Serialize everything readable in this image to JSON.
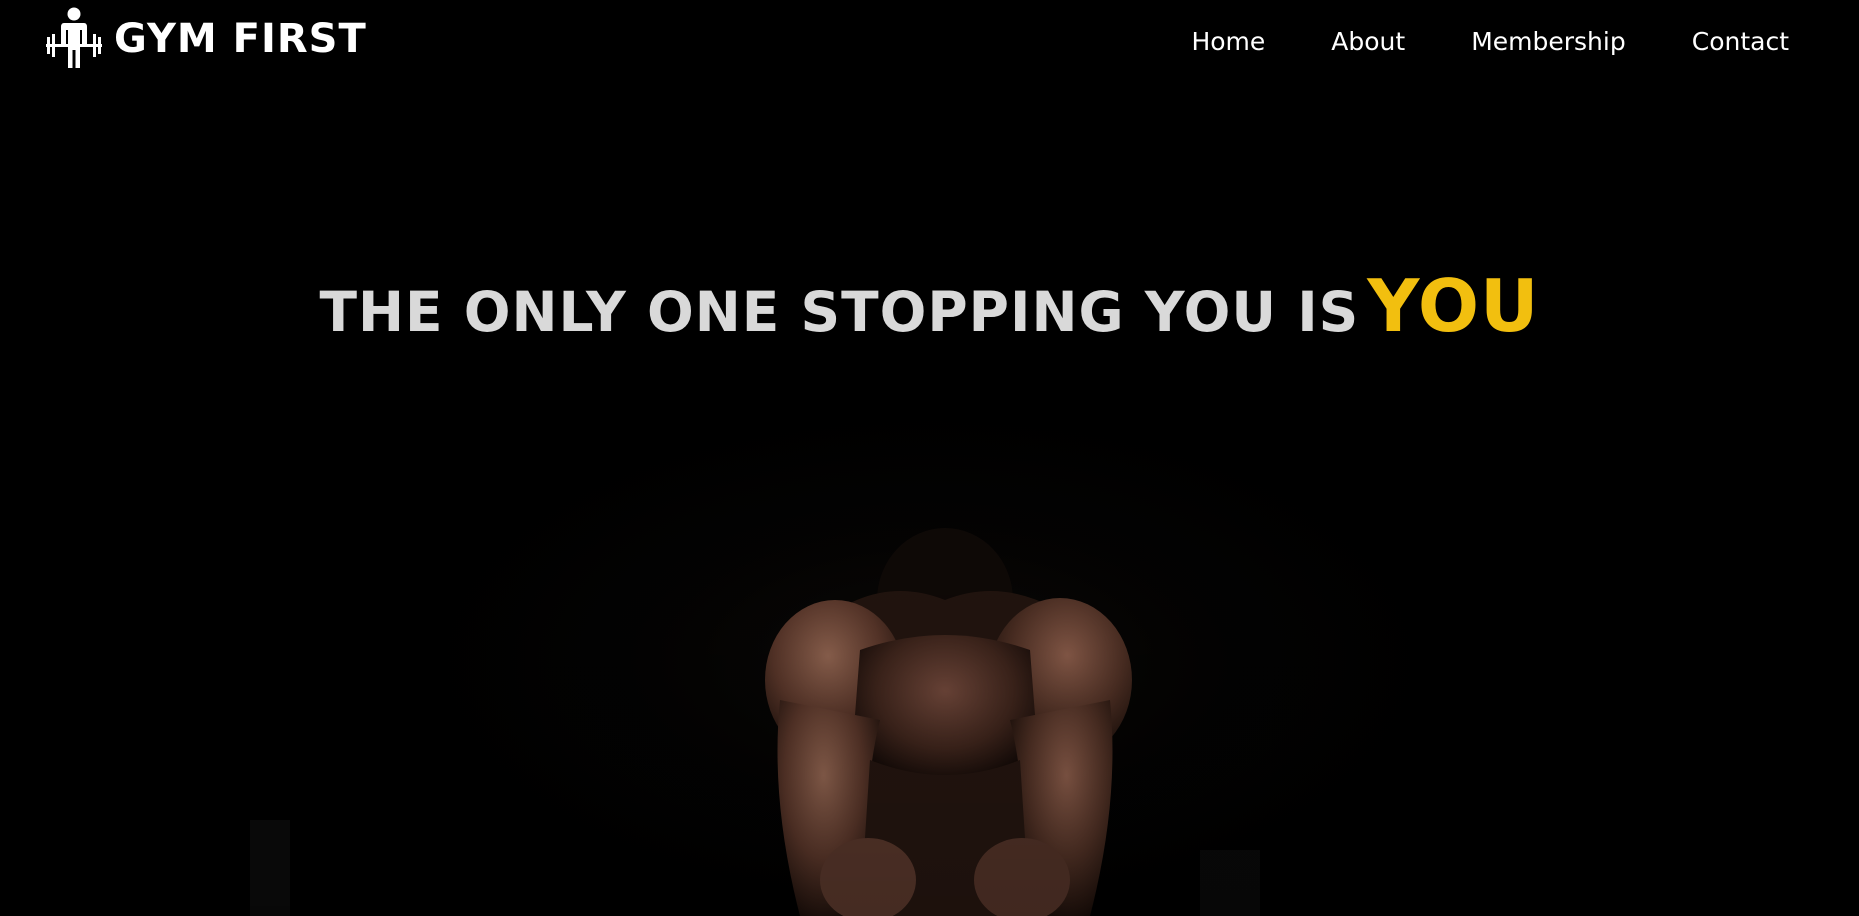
{
  "brand": {
    "name": "GYM FIRST",
    "logo_icon": "weightlifter-icon"
  },
  "nav": {
    "items": [
      {
        "label": "Home"
      },
      {
        "label": "About"
      },
      {
        "label": "Membership"
      },
      {
        "label": "Contact"
      }
    ]
  },
  "hero": {
    "headline_main": "THE ONLY ONE STOPPING YOU IS",
    "headline_accent": "YOU",
    "background_image": "athlete-crouching-photo"
  },
  "colors": {
    "background": "#000000",
    "headline_text": "#d9d9d9",
    "accent": "#f2bf0f",
    "nav_text": "#ffffff"
  }
}
